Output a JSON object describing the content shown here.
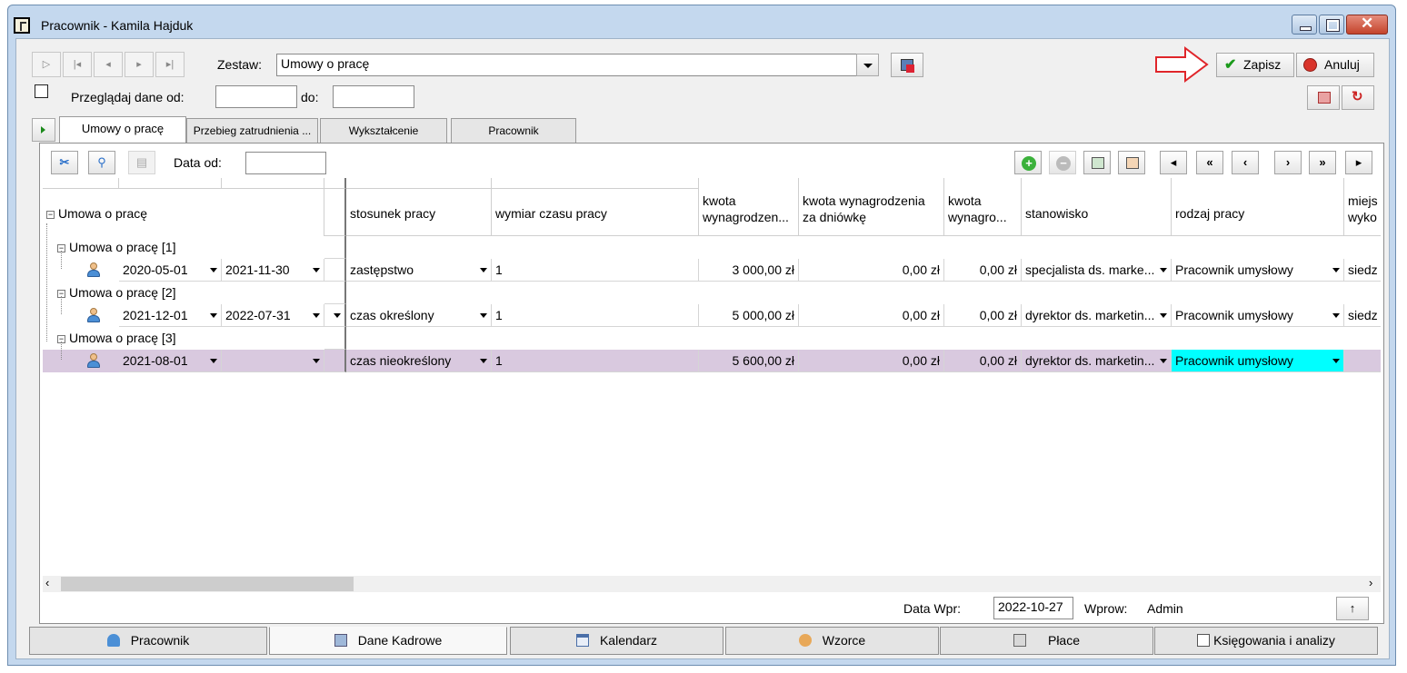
{
  "window": {
    "title": "Pracownik - Kamila Hajduk"
  },
  "toolbar": {
    "zestaw_label": "Zestaw:",
    "zestaw_value": "Umowy o pracę",
    "browse_label": "Przeglądaj dane od:",
    "browse_from": "",
    "to_label": "do:",
    "browse_to": "",
    "save": "Zapisz",
    "cancel": "Anuluj"
  },
  "tabs": [
    "Umowy o pracę",
    "Przebieg zatrudnienia ...",
    "Wykształcenie",
    "Pracownik"
  ],
  "panel": {
    "date_from_label": "Data od:",
    "date_from_value": ""
  },
  "grid": {
    "headers": {
      "root": "Umowa o pracę",
      "stosunek": "stosunek pracy",
      "wymiar": "wymiar czasu pracy",
      "kwota": "kwota wynagrodzen...",
      "kwota_dn": "kwota wynagrodzenia za dniówkę",
      "kwota_w": "kwota wynagro...",
      "stanowisko": "stanowisko",
      "rodzaj": "rodzaj pracy",
      "miejsce": "miejs wyko"
    },
    "groups": [
      {
        "label": "Umowa o pracę [1]",
        "date_from": "2020-05-01",
        "date_to": "2021-11-30",
        "stosunek": "zastępstwo",
        "wymiar": "1",
        "kwota": "3 000,00 zł",
        "kwota_dn": "0,00 zł",
        "kwota_w": "0,00 zł",
        "stanowisko": "specjalista ds. marke...",
        "rodzaj": "Pracownik umysłowy",
        "miejsce": "siedz"
      },
      {
        "label": "Umowa o pracę [2]",
        "date_from": "2021-12-01",
        "date_to": "2022-07-31",
        "stosunek": "czas określony",
        "wymiar": "1",
        "kwota": "5 000,00 zł",
        "kwota_dn": "0,00 zł",
        "kwota_w": "0,00 zł",
        "stanowisko": "dyrektor ds. marketin...",
        "rodzaj": "Pracownik umysłowy",
        "miejsce": "siedz"
      },
      {
        "label": "Umowa o pracę [3]",
        "date_from": "2021-08-01",
        "date_to": "",
        "stosunek": "czas nieokreślony",
        "wymiar": "1",
        "kwota": "5 600,00 zł",
        "kwota_dn": "0,00 zł",
        "kwota_w": "0,00 zł",
        "stanowisko": "dyrektor ds. marketin...",
        "rodzaj": "Pracownik umysłowy",
        "miejsce": ""
      }
    ]
  },
  "footer": {
    "data_wpr_label": "Data Wpr:",
    "data_wpr_value": "2022-10-27",
    "wprow_label": "Wprow:",
    "wprow_value": "Admin"
  },
  "bottom_tabs": [
    "Pracownik",
    "Dane Kadrowe",
    "Kalendarz",
    "Wzorce",
    "Płace",
    "Księgowania i analizy"
  ],
  "colors": {
    "selected_row": "#d9c9df",
    "highlight_cell": "#00ffff",
    "arrow": "#e0252a"
  }
}
